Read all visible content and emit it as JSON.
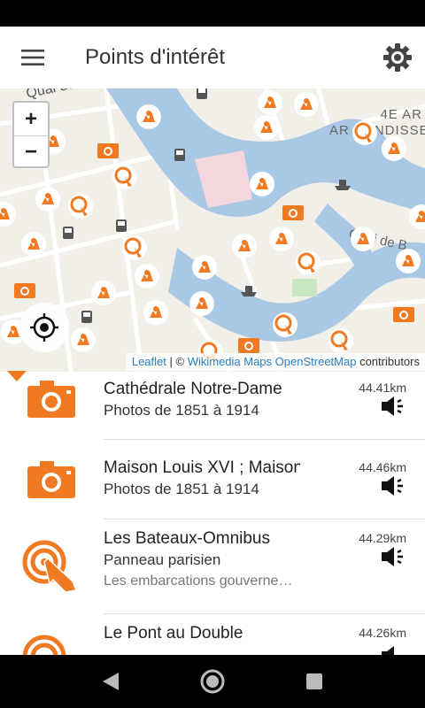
{
  "app_bar": {
    "title": "Points d'intérêt",
    "menu_icon": "hamburger-menu-icon",
    "settings_icon": "gear-icon"
  },
  "map": {
    "zoom_in": "+",
    "zoom_out": "−",
    "labels": {
      "street": "Quai de l'Horloge",
      "district": "4E AR",
      "district_suffix": "NDISSE",
      "quai_right": "Quai de B"
    },
    "attribution": {
      "leaflet": "Leaflet",
      "sep": " | © ",
      "wikimedia": "Wikimedia Maps",
      "osm": "OpenStreetMap",
      "contrib": " contributors"
    },
    "colors": {
      "water": "#a9c8e6",
      "land": "#f1efe8",
      "marker": "#ef7a22",
      "block": "#f5d6dd"
    }
  },
  "list": {
    "items": [
      {
        "title": "Cathédrale Notre-Dame",
        "subtitle": "Photos de 1851 à 1914",
        "distance": "44.41km",
        "icon": "camera-icon",
        "desc": ""
      },
      {
        "title": "Maison Louis XVI ; Maison",
        "subtitle": "Photos de 1851 à 1914",
        "distance": "44.46km",
        "icon": "camera-icon",
        "desc": ""
      },
      {
        "title": "Les Bateaux-Omnibus",
        "subtitle": "Panneau parisien",
        "distance": "44.29km",
        "icon": "touch-point-icon",
        "desc": "Les embarcations gouvernementales"
      },
      {
        "title": "Le Pont au Double",
        "subtitle": "",
        "distance": "44.26km",
        "icon": "touch-point-icon",
        "desc": ""
      }
    ]
  },
  "nav": {
    "back": "back-triangle-icon",
    "home": "home-circle-icon",
    "recents": "recents-square-icon"
  }
}
